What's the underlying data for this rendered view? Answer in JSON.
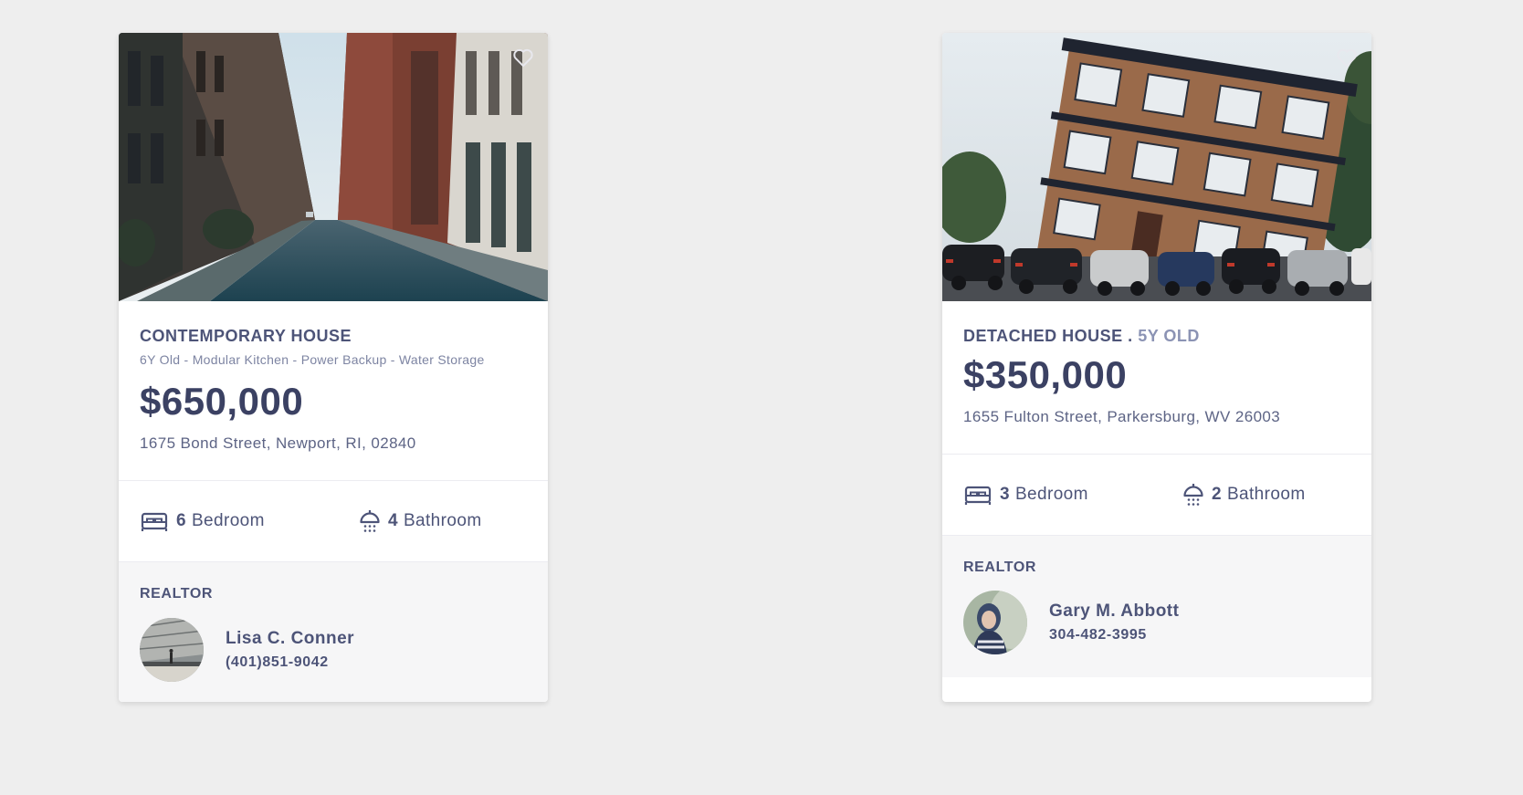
{
  "colors": {
    "page_background": "#eeeeee",
    "card_background": "#ffffff",
    "realtor_background": "#f6f6f7",
    "text_primary": "#3b4163",
    "text_secondary": "#7d84a2",
    "age_accent": "#8b93b4"
  },
  "listings": [
    {
      "photo": "city-street-photo",
      "favorite_icon": "heart-outline-icon",
      "type": "CONTEMPORARY HOUSE",
      "age_tag": "",
      "features": "6Y Old - Modular Kitchen - Power Backup - Water Storage",
      "price": "$650,000",
      "address": "1675 Bond Street, Newport, RI, 02840",
      "bedrooms": {
        "count": "6",
        "label": "Bedroom",
        "icon": "bed-icon"
      },
      "bathrooms": {
        "count": "4",
        "label": "Bathroom",
        "icon": "shower-icon"
      },
      "realtor": {
        "title": "REALTOR",
        "name": "Lisa C. Conner",
        "phone": "(401)851-9042",
        "avatar": "realtor-avatar"
      }
    },
    {
      "photo": "leaning-building-photo",
      "favorite_icon": "heart-outline-icon",
      "type": "DETACHED HOUSE . ",
      "age_tag": "5Y OLD",
      "features": "",
      "price": "$350,000",
      "address": "1655 Fulton Street, Parkersburg, WV 26003",
      "bedrooms": {
        "count": "3",
        "label": "Bedroom",
        "icon": "bed-icon"
      },
      "bathrooms": {
        "count": "2",
        "label": "Bathroom",
        "icon": "shower-icon"
      },
      "realtor": {
        "title": "REALTOR",
        "name": "Gary M. Abbott",
        "phone": "304-482-3995",
        "avatar": "realtor-avatar"
      }
    }
  ]
}
